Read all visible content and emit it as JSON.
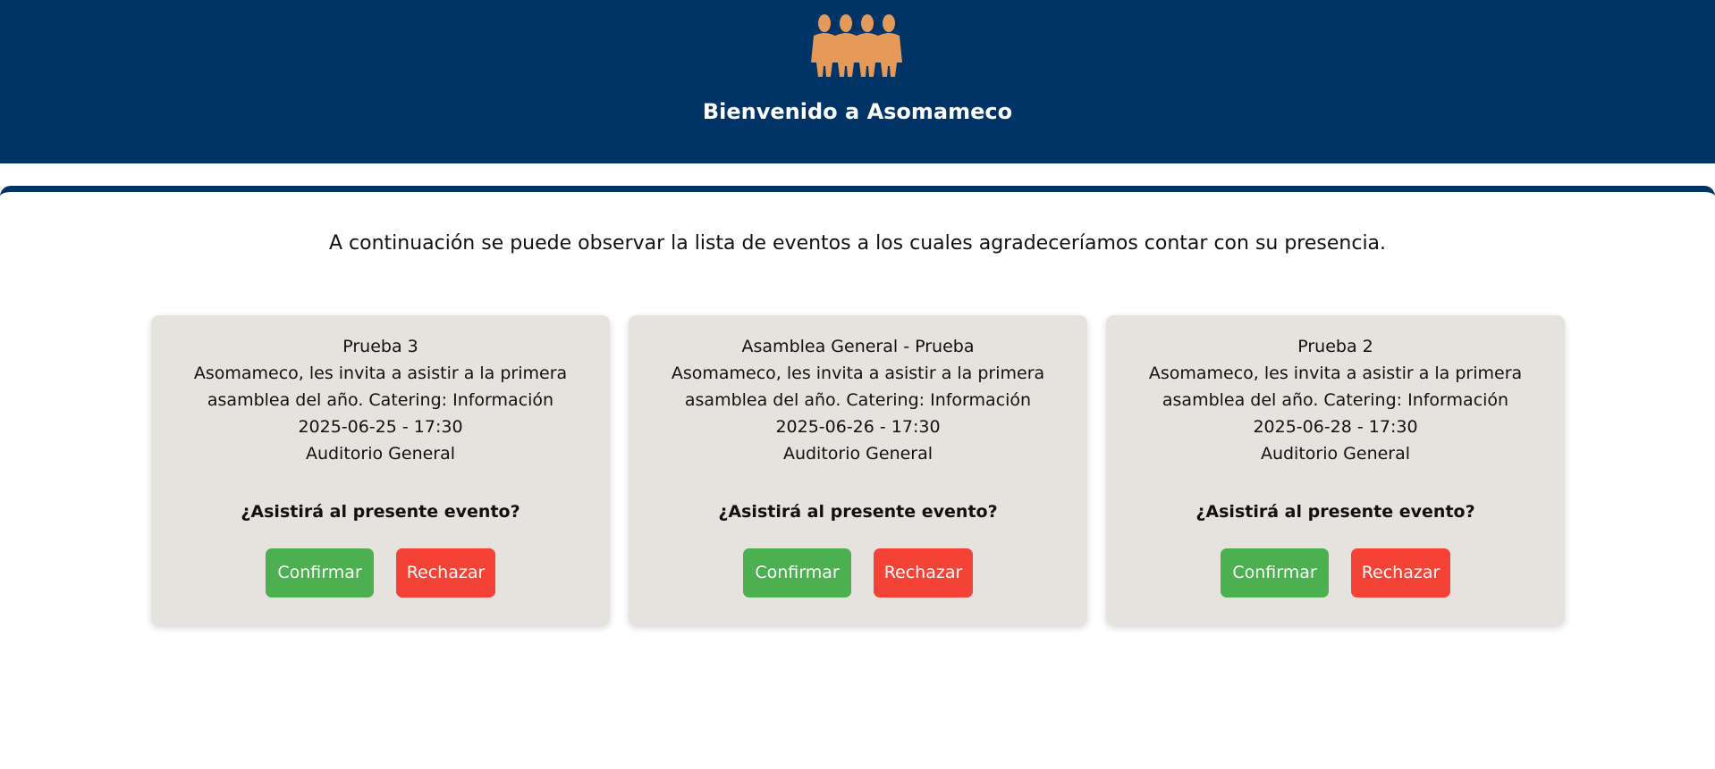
{
  "header": {
    "welcome": "Bienvenido a Asomameco",
    "logo_icon": "people-group-icon",
    "background_color": "#003366",
    "logo_color": "#E59A5A"
  },
  "intro": {
    "text": "A continuación se puede observar la lista de eventos a los cuales agradeceríamos contar con su presencia."
  },
  "events": [
    {
      "title": "Prueba 3",
      "description": "Asomameco, les invita a asistir a la primera asamblea del año. Catering: Información",
      "datetime": "2025-06-25 - 17:30",
      "location": "Auditorio General",
      "question": "¿Asistirá al presente evento?",
      "confirm_label": "Confirmar",
      "reject_label": "Rechazar"
    },
    {
      "title": "Asamblea General - Prueba",
      "description": "Asomameco, les invita a asistir a la primera asamblea del año. Catering: Información",
      "datetime": "2025-06-26 - 17:30",
      "location": "Auditorio General",
      "question": "¿Asistirá al presente evento?",
      "confirm_label": "Confirmar",
      "reject_label": "Rechazar"
    },
    {
      "title": "Prueba 2",
      "description": "Asomameco, les invita a asistir a la primera asamblea del año. Catering: Información",
      "datetime": "2025-06-28 - 17:30",
      "location": "Auditorio General",
      "question": "¿Asistirá al presente evento?",
      "confirm_label": "Confirmar",
      "reject_label": "Rechazar"
    }
  ],
  "colors": {
    "card_background": "#E6E2DD",
    "confirm_button": "#4CAF50",
    "reject_button": "#F44336"
  }
}
